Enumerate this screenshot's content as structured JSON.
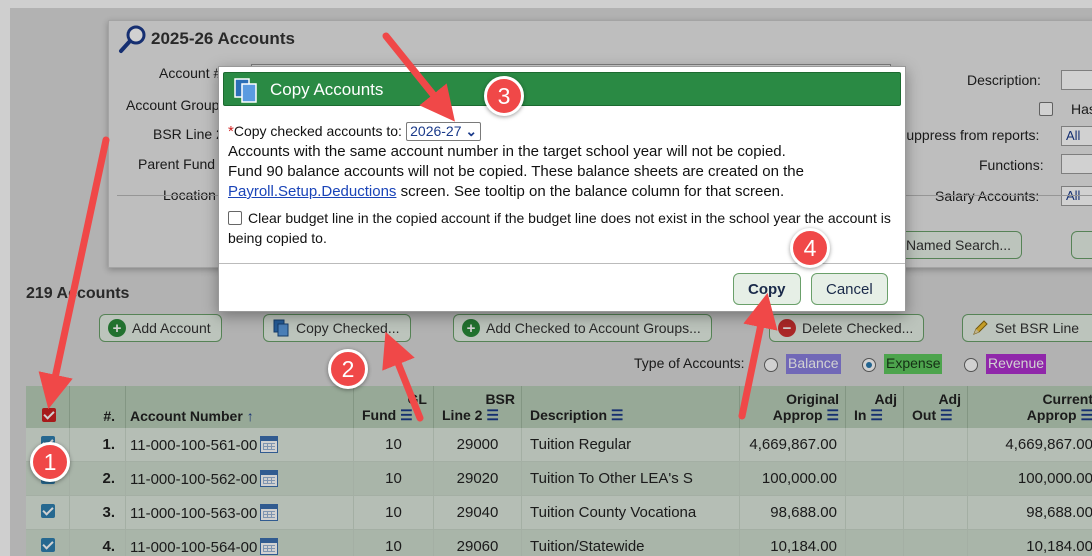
{
  "search_panel": {
    "title": "2025-26 Accounts",
    "labels": {
      "account": "Account #",
      "account_group": "Account Group",
      "bsr_line": "BSR Line 2",
      "parent_fund": "Parent Fund",
      "location": "Location",
      "description": "Description:",
      "has": "Has",
      "suppress": "Suppress from reports:",
      "functions": "Functions:",
      "salary": "Salary Accounts:"
    },
    "suppress_value": "All",
    "salary_value": "All",
    "named_search": "Named Search..."
  },
  "list": {
    "count_title": "219 Accounts",
    "toolbar": {
      "add_account": "Add Account",
      "copy_checked": "Copy Checked...",
      "add_to_groups": "Add Checked to Account Groups...",
      "delete_checked": "Delete Checked...",
      "set_bsr": "Set BSR Line"
    },
    "type_label": "Type of Accounts:",
    "types": {
      "balance": "Balance",
      "expense": "Expense",
      "revenue": "Revenue"
    },
    "colors": {
      "balance": "#8a7fe0",
      "expense": "#5ec85e",
      "revenue": "#b030d0"
    },
    "headers": {
      "num": "#.",
      "account_number": "Account Number",
      "gl": "GL",
      "fund": "Fund",
      "bsr": "BSR",
      "line2": "Line 2",
      "description": "Description",
      "original": "Original",
      "approp": "Approp",
      "adj": "Adj",
      "in": "In",
      "out": "Out",
      "current": "Current"
    },
    "rows": [
      {
        "num": "1.",
        "account": "11-000-100-561-00",
        "fund": "10",
        "bsr": "29000",
        "desc": "Tuition Regular",
        "orig": "4,669,867.00",
        "current": "4,669,867.00"
      },
      {
        "num": "2.",
        "account": "11-000-100-562-00",
        "fund": "10",
        "bsr": "29020",
        "desc": "Tuition To Other LEA's S",
        "orig": "100,000.00",
        "current": "100,000.00"
      },
      {
        "num": "3.",
        "account": "11-000-100-563-00",
        "fund": "10",
        "bsr": "29040",
        "desc": "Tuition County Vocationa",
        "orig": "98,688.00",
        "current": "98,688.00"
      },
      {
        "num": "4.",
        "account": "11-000-100-564-00",
        "fund": "10",
        "bsr": "29060",
        "desc": "Tuition/Statewide",
        "orig": "10,184.00",
        "current": "10,184.00"
      }
    ]
  },
  "modal": {
    "title": "Copy Accounts",
    "required_mark": "*",
    "copy_to_label": "Copy checked accounts to:",
    "year": "2026-27",
    "chevron": "⌄",
    "line1": "Accounts with the same account number in the target school year will not be copied.",
    "line2": "Fund 90 balance accounts will not be copied. These balance sheets are created on the",
    "link": "Payroll.Setup.Deductions",
    "line3": " screen. See tooltip on the balance column for that screen.",
    "clear_label": "Clear budget line in the copied account if the budget line does not exist in the school year the account is being copied to.",
    "copy_button": "Copy",
    "cancel_button": "Cancel"
  },
  "annotations": [
    "1",
    "2",
    "3",
    "4"
  ],
  "annotation_color": "#f04848"
}
